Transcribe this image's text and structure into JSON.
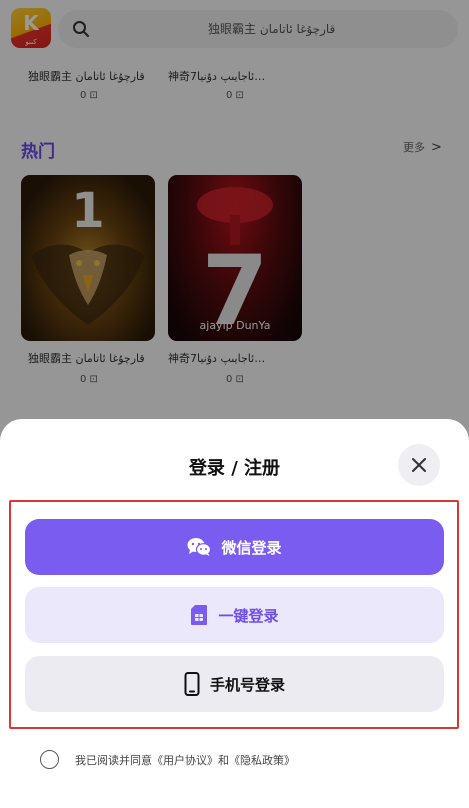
{
  "app": {
    "logo_label": "K",
    "logo_caption": "كىنو"
  },
  "search": {
    "placeholder": "独眼霸主   قارچۇغا ئاتامان"
  },
  "top_row": [
    {
      "caption": "独眼霸主   قارچۇغا ئاتامان",
      "count": "0 ⊡"
    },
    {
      "caption": "神奇7ئاجايىپ دۇنيا…",
      "count": "0 ⊡"
    }
  ],
  "hot": {
    "title": "热门",
    "more_label": "更多",
    "more_chevron": ">"
  },
  "cards": [
    {
      "cover_text": "1",
      "caption": "独眼霸主   قارچۇغا ئاتامان",
      "count": "0 ⊡"
    },
    {
      "cover_text": "7",
      "cover_subtitle": "ajayip DunYa",
      "caption": "神奇7ئاجايىپ دۇنيا…",
      "count": "0 ⊡"
    }
  ],
  "login": {
    "title": "登录 / 注册",
    "wechat_label": "微信登录",
    "onekey_label": "一键登录",
    "phone_label": "手机号登录",
    "agreement": "我已阅读并同意《用户协议》和《隐私政策》"
  },
  "colors": {
    "accent": "#7b5cf0",
    "onekey_bg": "#ece8fb",
    "phone_bg": "#ecebf2",
    "highlight": "#d9372f"
  },
  "icons": {
    "search": "search-icon",
    "close": "close-icon",
    "wechat": "wechat-icon",
    "sim": "sim-card-icon",
    "phone": "phone-icon"
  }
}
